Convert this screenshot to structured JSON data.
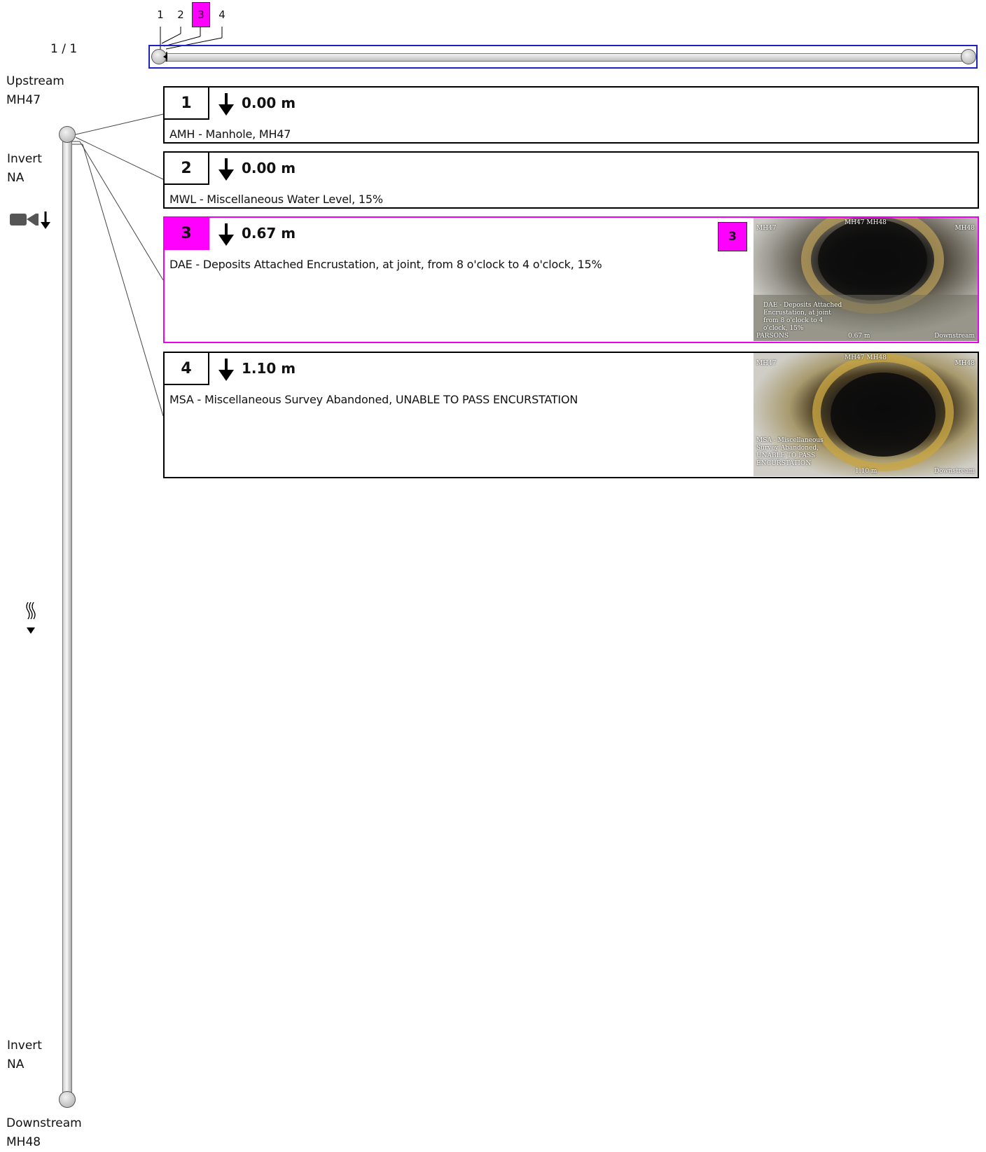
{
  "page_indicator": "1 / 1",
  "overview": {
    "ticks": [
      "1",
      "2",
      "3",
      "4"
    ],
    "highlighted_tick": "3"
  },
  "pipe": {
    "upstream_label": "Upstream",
    "upstream_node": "MH47",
    "upstream_invert_label": "Invert",
    "upstream_invert_value": "NA",
    "downstream_invert_label": "Invert",
    "downstream_invert_value": "NA",
    "downstream_label": "Downstream",
    "downstream_node": "MH48",
    "camera_icon": "camera-down-icon",
    "flow_icon": "flow-direction-icon"
  },
  "observations": [
    {
      "index": "1",
      "distance": "0.00 m",
      "description": "AMH - Manhole, MH47",
      "has_image": false
    },
    {
      "index": "2",
      "distance": "0.00 m",
      "description": "MWL - Miscellaneous Water Level, 15%",
      "has_image": false
    },
    {
      "index": "3",
      "distance": "0.67 m",
      "description": "DAE - Deposits Attached Encrustation, at joint, from 8 o'clock to 4 o'clock, 15%",
      "has_image": true,
      "selected": true,
      "image_badge": "3",
      "image_overlay": {
        "top_center": "MH47 MH48",
        "top_left": "MH47",
        "top_right": "MH48",
        "caption_lines": [
          "DAE - Deposits Attached",
          "Encrustation, at joint",
          "from 8 o'clock to 4",
          "o'clock, 15%"
        ],
        "bottom_left": "PARSONS",
        "bottom_center": "0.67 m",
        "bottom_right": "Downstream"
      }
    },
    {
      "index": "4",
      "distance": "1.10 m",
      "description": "MSA - Miscellaneous Survey Abandoned, UNABLE TO PASS ENCURSTATION",
      "has_image": true,
      "image_overlay": {
        "top_center": "MH47 MH48",
        "top_left": "MH47",
        "top_right": "MH48",
        "caption_lines": [
          "MSA - Miscellaneous",
          "Survey Abandoned,",
          "UNABLE TO PASS",
          "ENCURSTATION"
        ],
        "bottom_center": "1.10 m",
        "bottom_right": "Downstream"
      }
    }
  ]
}
